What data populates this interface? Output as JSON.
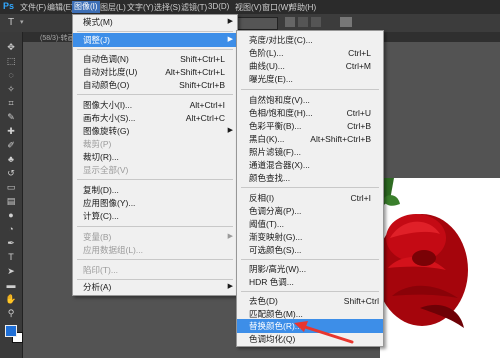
{
  "app": {
    "logo": "Ps"
  },
  "menubar": [
    {
      "label": "文件(F)"
    },
    {
      "label": "编辑(E)"
    },
    {
      "label": "图像(I)"
    },
    {
      "label": "图层(L)"
    },
    {
      "label": "文字(Y)"
    },
    {
      "label": "选择(S)"
    },
    {
      "label": "滤镜(T)"
    },
    {
      "label": "3D(D)"
    },
    {
      "label": "视图(V)"
    },
    {
      "label": "窗口(W)"
    },
    {
      "label": "帮助(H)"
    }
  ],
  "doc_tab": "(58/3)-转画图.psd @ ...",
  "image_menu": [
    {
      "label": "模式(M)",
      "shortcut": "",
      "submenu": true
    },
    {
      "label": "调整(J)",
      "shortcut": "",
      "submenu": true,
      "highlighted": true
    },
    {
      "label": "自动色调(N)",
      "shortcut": "Shift+Ctrl+L"
    },
    {
      "label": "自动对比度(U)",
      "shortcut": "Alt+Shift+Ctrl+L"
    },
    {
      "label": "自动颜色(O)",
      "shortcut": "Shift+Ctrl+B"
    },
    {
      "label": "图像大小(I)...",
      "shortcut": "Alt+Ctrl+I"
    },
    {
      "label": "画布大小(S)...",
      "shortcut": "Alt+Ctrl+C"
    },
    {
      "label": "图像旋转(G)",
      "shortcut": "",
      "submenu": true
    },
    {
      "label": "裁剪(P)",
      "shortcut": "",
      "disabled": true
    },
    {
      "label": "裁切(R)...",
      "shortcut": ""
    },
    {
      "label": "显示全部(V)",
      "shortcut": "",
      "disabled": true
    },
    {
      "label": "复制(D)...",
      "shortcut": ""
    },
    {
      "label": "应用图像(Y)...",
      "shortcut": ""
    },
    {
      "label": "计算(C)...",
      "shortcut": ""
    },
    {
      "label": "变量(B)",
      "shortcut": "",
      "submenu": true,
      "disabled": true
    },
    {
      "label": "应用数据组(L)...",
      "shortcut": "",
      "disabled": true
    },
    {
      "label": "陷印(T)...",
      "shortcut": "",
      "disabled": true
    },
    {
      "label": "分析(A)",
      "shortcut": "",
      "submenu": true
    }
  ],
  "adjust_menu": [
    {
      "label": "亮度/对比度(C)...",
      "shortcut": ""
    },
    {
      "label": "色阶(L)...",
      "shortcut": "Ctrl+L"
    },
    {
      "label": "曲线(U)...",
      "shortcut": "Ctrl+M"
    },
    {
      "label": "曝光度(E)...",
      "shortcut": ""
    },
    {
      "label": "自然饱和度(V)...",
      "shortcut": ""
    },
    {
      "label": "色相/饱和度(H)...",
      "shortcut": "Ctrl+U"
    },
    {
      "label": "色彩平衡(B)...",
      "shortcut": "Ctrl+B"
    },
    {
      "label": "黑白(K)...",
      "shortcut": "Alt+Shift+Ctrl+B"
    },
    {
      "label": "照片滤镜(F)...",
      "shortcut": ""
    },
    {
      "label": "通道混合器(X)...",
      "shortcut": ""
    },
    {
      "label": "颜色查找...",
      "shortcut": ""
    },
    {
      "label": "反相(I)",
      "shortcut": "Ctrl+I"
    },
    {
      "label": "色调分离(P)...",
      "shortcut": ""
    },
    {
      "label": "阈值(T)...",
      "shortcut": ""
    },
    {
      "label": "渐变映射(G)...",
      "shortcut": ""
    },
    {
      "label": "可选颜色(S)...",
      "shortcut": ""
    },
    {
      "label": "阴影/高光(W)...",
      "shortcut": ""
    },
    {
      "label": "HDR 色调...",
      "shortcut": ""
    },
    {
      "label": "去色(D)",
      "shortcut": "Shift+Ctrl"
    },
    {
      "label": "匹配颜色(M)...",
      "shortcut": ""
    },
    {
      "label": "替换颜色(R)...",
      "shortcut": "",
      "highlighted": true
    },
    {
      "label": "色调均化(Q)",
      "shortcut": ""
    }
  ],
  "colors": {
    "accent": "#3d8ee8",
    "arrow": "#e8362f",
    "fg_swatch": "#1f6fd6"
  }
}
